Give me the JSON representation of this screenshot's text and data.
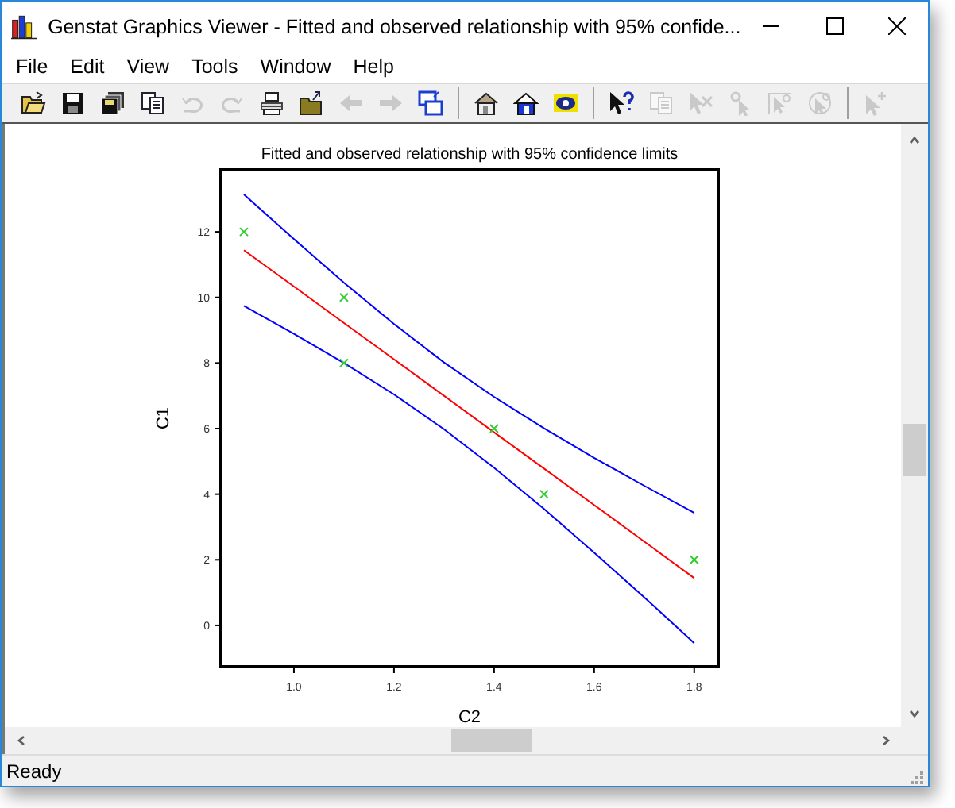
{
  "window": {
    "title": "Genstat Graphics Viewer - Fitted and observed relationship with 95% confide..."
  },
  "menu": {
    "items": [
      "File",
      "Edit",
      "View",
      "Tools",
      "Window",
      "Help"
    ]
  },
  "toolbar": [
    {
      "kind": "open",
      "disabled": false
    },
    {
      "kind": "save",
      "disabled": false
    },
    {
      "kind": "save-all",
      "disabled": false
    },
    {
      "kind": "copy",
      "disabled": false
    },
    {
      "kind": "undo",
      "disabled": true
    },
    {
      "kind": "redo",
      "disabled": true
    },
    {
      "kind": "print",
      "disabled": false
    },
    {
      "kind": "export",
      "disabled": false
    },
    {
      "kind": "back",
      "disabled": true
    },
    {
      "kind": "forward",
      "disabled": true
    },
    {
      "kind": "windows",
      "disabled": false
    },
    {
      "kind": "separator"
    },
    {
      "kind": "house-outline",
      "disabled": false
    },
    {
      "kind": "house",
      "disabled": false
    },
    {
      "kind": "eye",
      "disabled": false
    },
    {
      "kind": "separator"
    },
    {
      "kind": "help-pointer",
      "disabled": false
    },
    {
      "kind": "copy",
      "disabled": true
    },
    {
      "kind": "delete-pointer",
      "disabled": true
    },
    {
      "kind": "key-pointer",
      "disabled": true
    },
    {
      "kind": "frame-pointer",
      "disabled": true
    },
    {
      "kind": "circle-pointer",
      "disabled": true
    },
    {
      "kind": "separator"
    },
    {
      "kind": "plus-pointer",
      "disabled": true
    }
  ],
  "chart": {
    "chart_data": {
      "type": "line",
      "title": "Fitted and observed relationship with 95% confidence limits",
      "xlabel": "C2",
      "ylabel": "C1",
      "x": [
        0.9,
        1.0,
        1.1,
        1.2,
        1.3,
        1.4,
        1.5,
        1.6,
        1.7,
        1.8
      ],
      "series": [
        {
          "type": "line",
          "color": "#0000ff",
          "values": [
            13.14,
            11.78,
            10.45,
            9.19,
            8.02,
            6.97,
            6.01,
            5.11,
            4.26,
            3.43
          ]
        },
        {
          "type": "line",
          "color": "#ff0000",
          "values": [
            11.44,
            10.33,
            9.22,
            8.11,
            7.0,
            5.89,
            4.78,
            3.67,
            2.56,
            1.44
          ]
        },
        {
          "type": "line",
          "color": "#0000ff",
          "values": [
            9.74,
            8.89,
            8.0,
            7.04,
            5.98,
            4.81,
            3.55,
            2.22,
            0.86,
            -0.54
          ]
        },
        {
          "type": "scatter",
          "marker": "x",
          "color": "#33cc33",
          "x": [
            0.9,
            1.1,
            1.1,
            1.4,
            1.5,
            1.8
          ],
          "values": [
            12,
            10,
            8,
            6,
            4,
            2
          ]
        }
      ],
      "xlim": [
        0.854,
        1.848
      ],
      "ylim": [
        -1.26,
        13.89
      ],
      "xticks": [
        {
          "value": 1.0,
          "label": "1.0"
        },
        {
          "value": 1.2,
          "label": "1.2"
        },
        {
          "value": 1.4,
          "label": "1.4"
        },
        {
          "value": 1.6,
          "label": "1.6"
        },
        {
          "value": 1.8,
          "label": "1.8"
        }
      ],
      "yticks": [
        0,
        2,
        4,
        6,
        8,
        10,
        12
      ]
    }
  },
  "status_bar": {
    "text": "Ready"
  }
}
